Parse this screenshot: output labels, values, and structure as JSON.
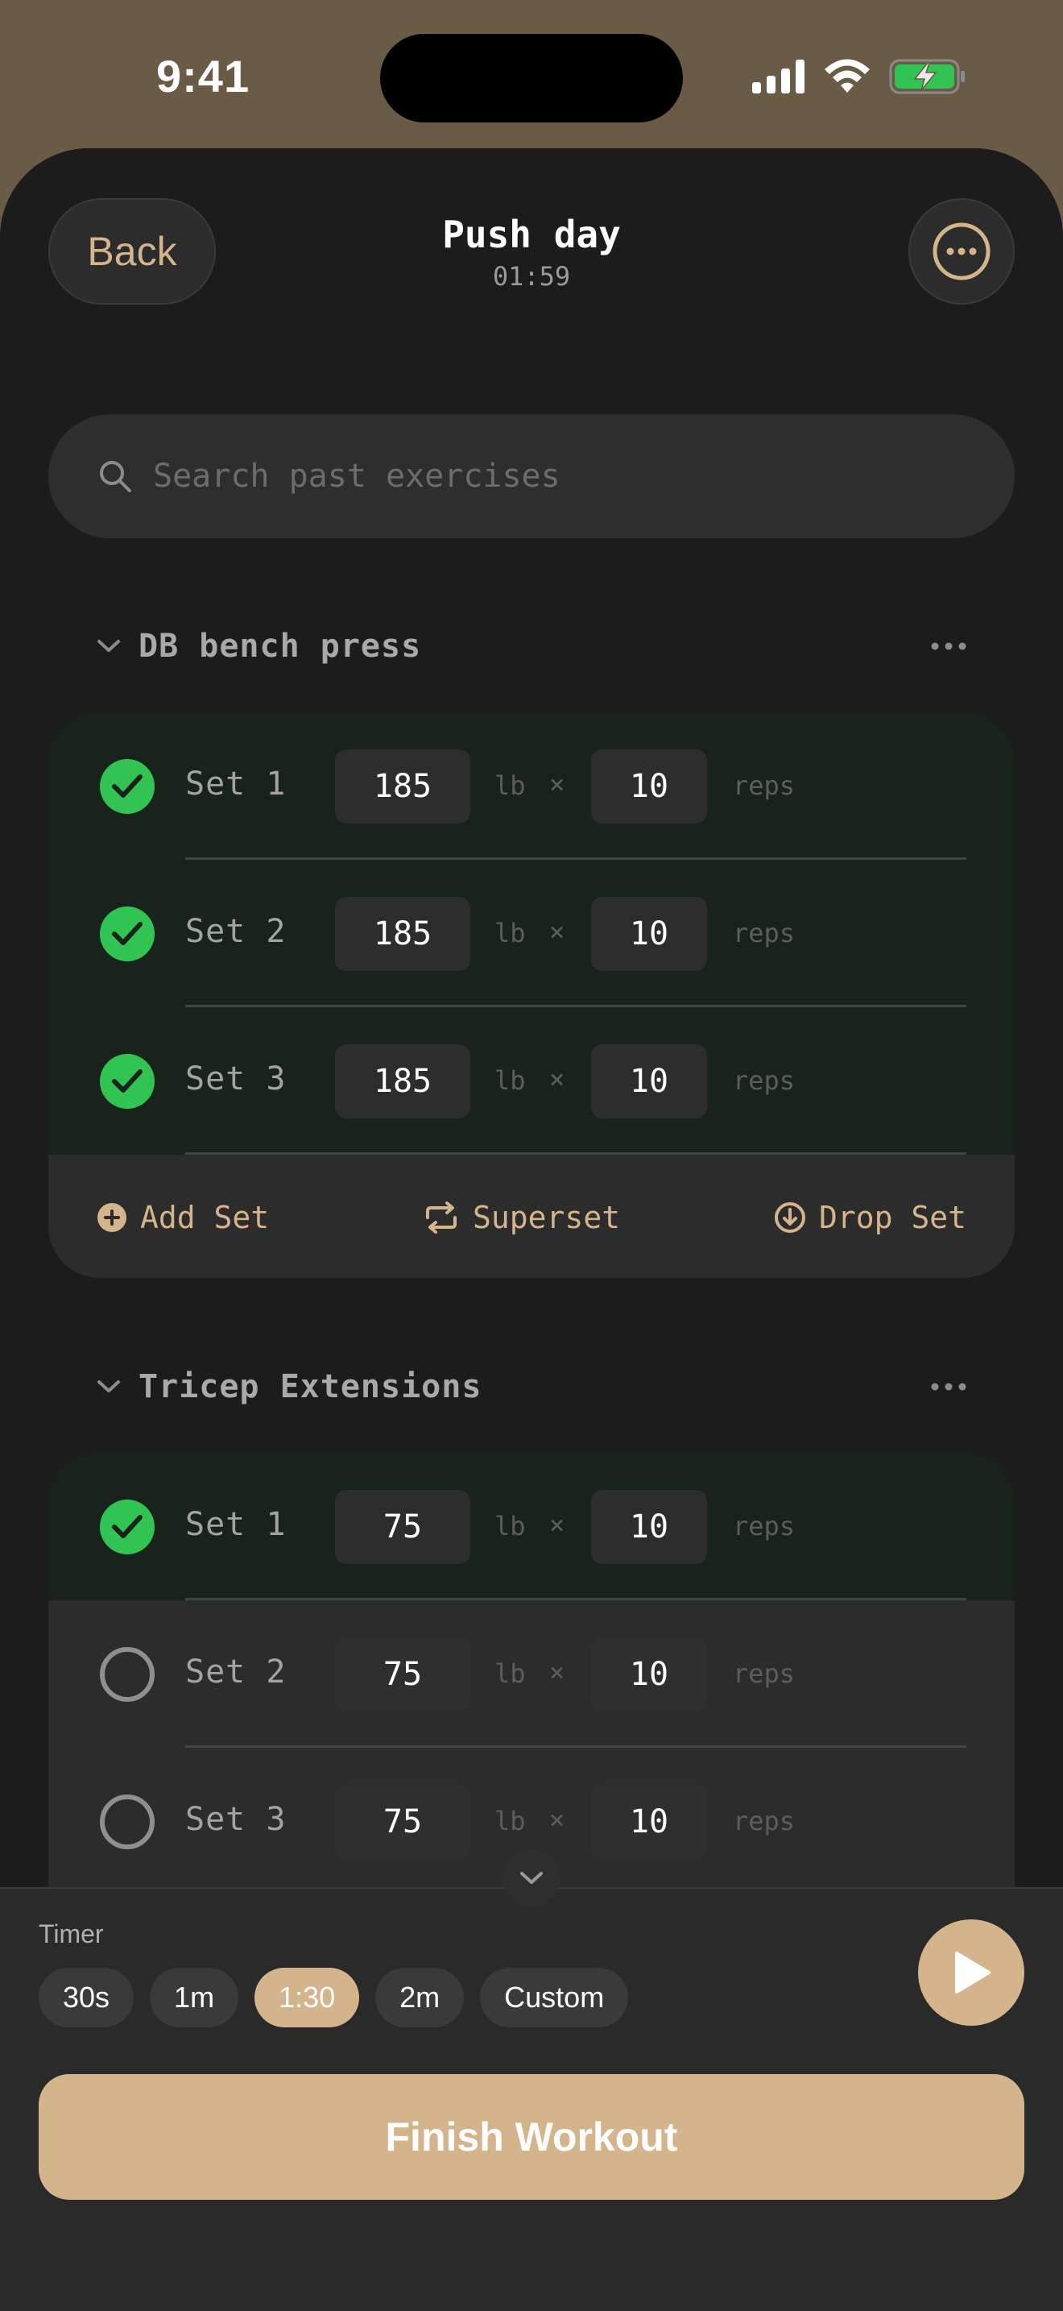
{
  "status_bar": {
    "time": "9:41"
  },
  "header": {
    "back_label": "Back",
    "title": "Push day",
    "timer": "01:59"
  },
  "search": {
    "placeholder": "Search past exercises"
  },
  "exercises": [
    {
      "name": "DB bench press",
      "sets": [
        {
          "label": "Set 1",
          "weight": "185",
          "unit": "lb",
          "times": "×",
          "reps": "10",
          "reps_unit": "reps",
          "done": true
        },
        {
          "label": "Set 2",
          "weight": "185",
          "unit": "lb",
          "times": "×",
          "reps": "10",
          "reps_unit": "reps",
          "done": true
        },
        {
          "label": "Set 3",
          "weight": "185",
          "unit": "lb",
          "times": "×",
          "reps": "10",
          "reps_unit": "reps",
          "done": true
        }
      ],
      "actions": {
        "add_set": "Add Set",
        "superset": "Superset",
        "drop_set": "Drop Set"
      }
    },
    {
      "name": "Tricep Extensions",
      "sets": [
        {
          "label": "Set 1",
          "weight": "75",
          "unit": "lb",
          "times": "×",
          "reps": "10",
          "reps_unit": "reps",
          "done": true
        },
        {
          "label": "Set 2",
          "weight": "75",
          "unit": "lb",
          "times": "×",
          "reps": "10",
          "reps_unit": "reps",
          "done": false
        },
        {
          "label": "Set 3",
          "weight": "75",
          "unit": "lb",
          "times": "×",
          "reps": "10",
          "reps_unit": "reps",
          "done": false
        }
      ]
    }
  ],
  "rest_timer": {
    "label": "Timer",
    "options": [
      "30s",
      "1m",
      "1:30",
      "2m",
      "Custom"
    ],
    "selected": "1:30"
  },
  "finish_label": "Finish Workout",
  "colors": {
    "accent": "#d4b48a",
    "check": "#32c453",
    "done_row": "#18241b"
  }
}
